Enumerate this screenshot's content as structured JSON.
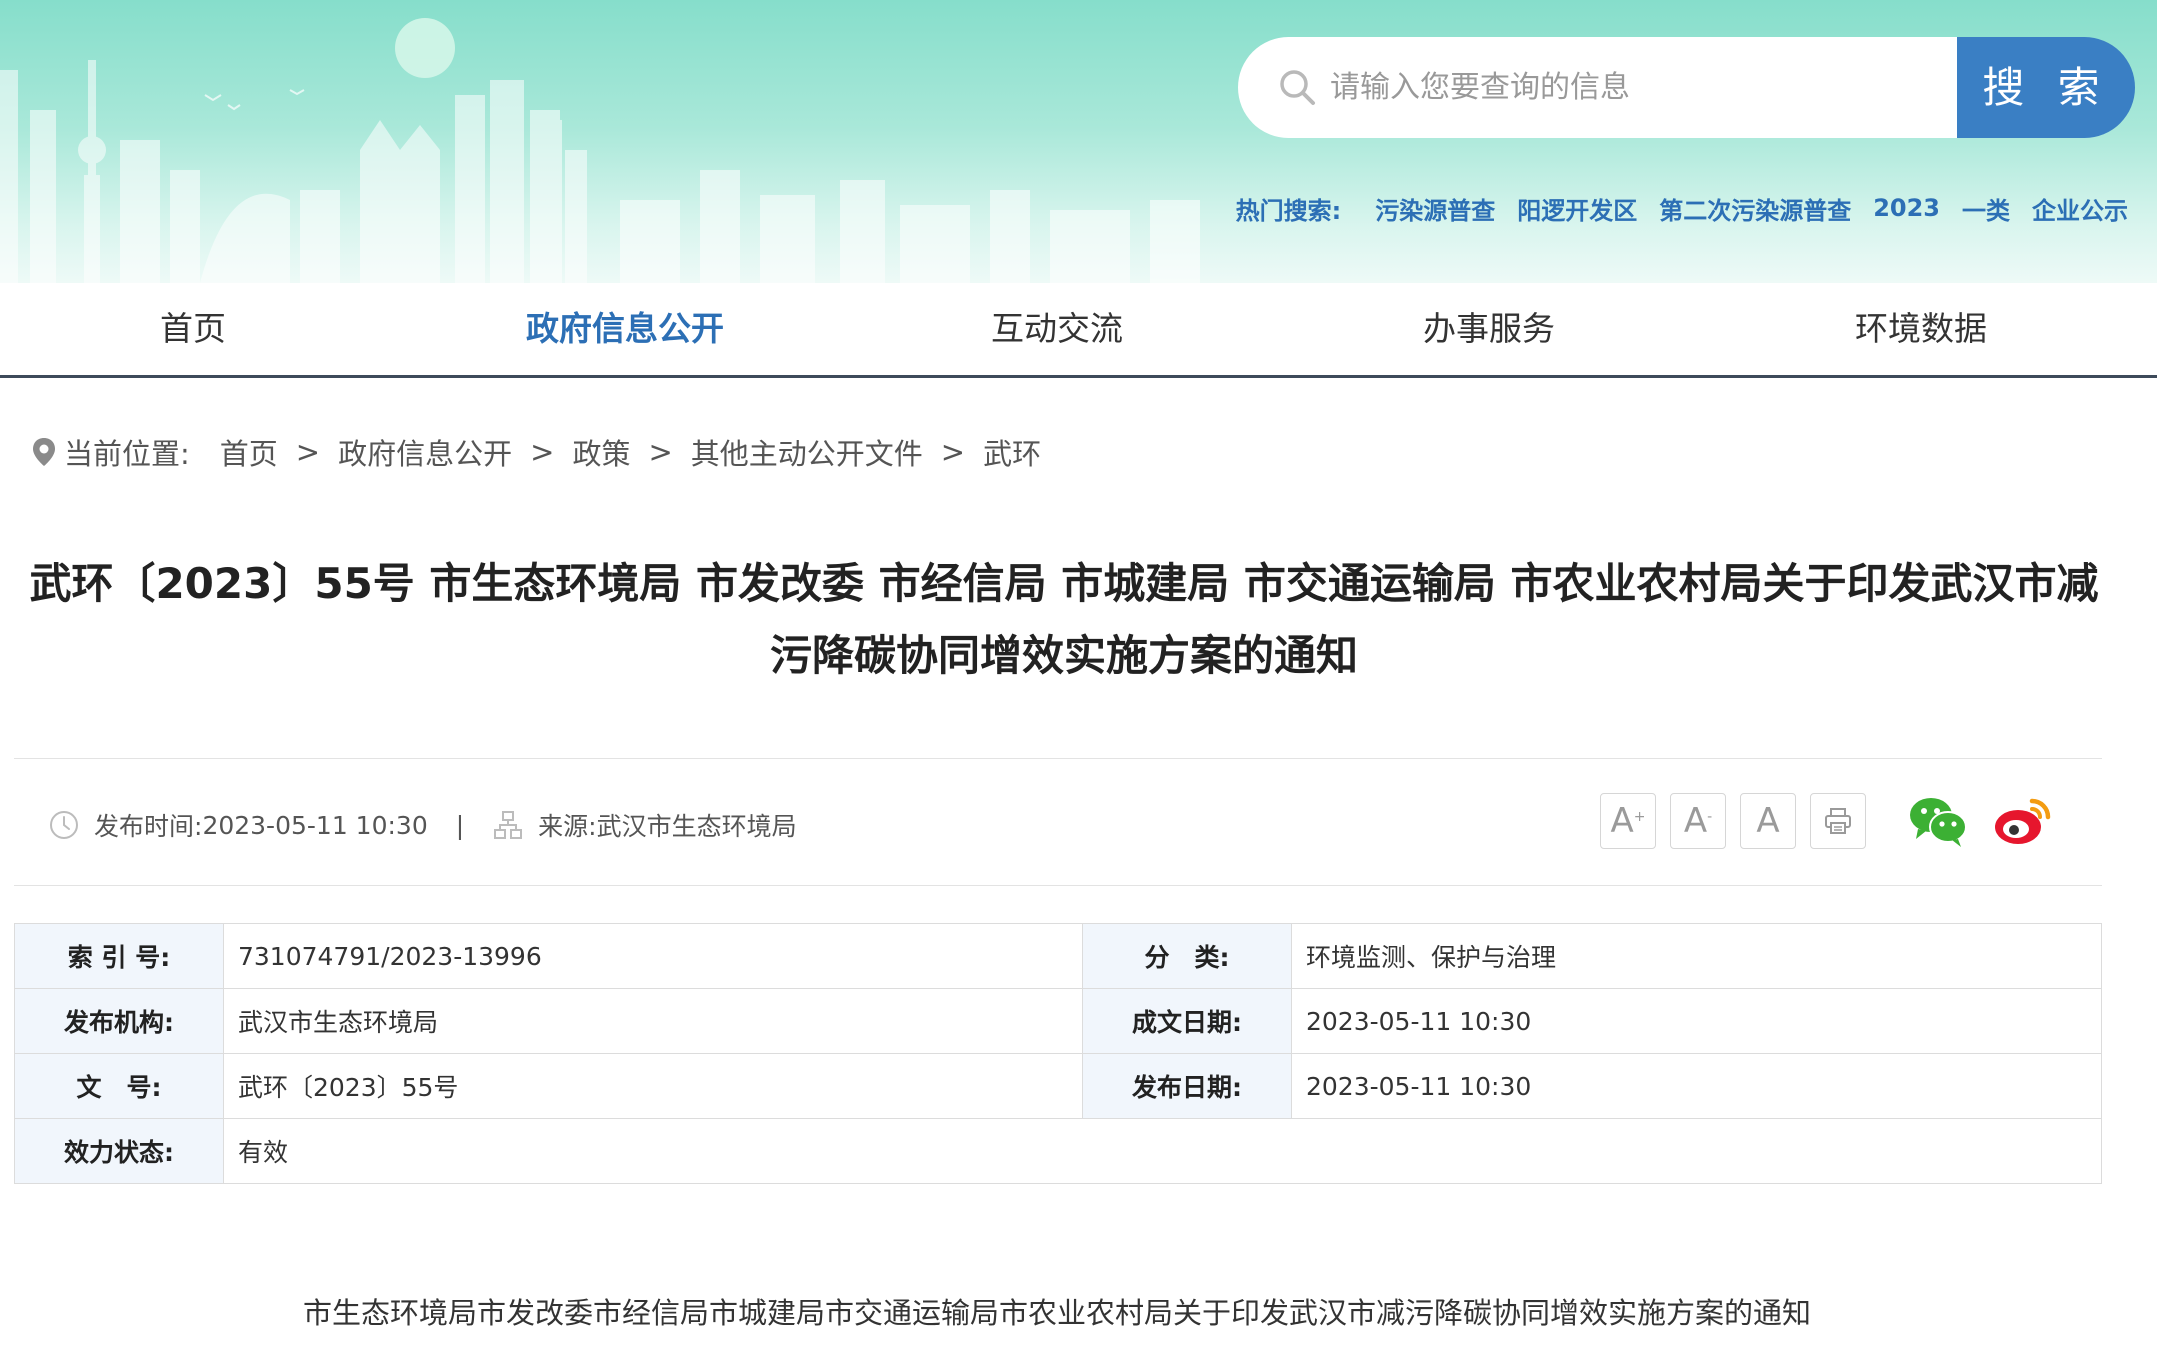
{
  "header": {
    "search_placeholder": "请输入您要查询的信息",
    "search_button": "搜 索",
    "hot_search_label": "热门搜索:",
    "hot_search_links": [
      "污染源普查",
      "阳逻开发区",
      "第二次污染源普查",
      "2023",
      "一类",
      "企业公示"
    ]
  },
  "nav": {
    "items": [
      "首页",
      "政府信息公开",
      "互动交流",
      "办事服务",
      "环境数据"
    ],
    "active": "政府信息公开"
  },
  "breadcrumb": {
    "label": "当前位置:",
    "items": [
      "首页",
      "政府信息公开",
      "政策",
      "其他主动公开文件",
      "武环"
    ],
    "separator": ">"
  },
  "article": {
    "title_line1": "武环〔2023〕55号 市生态环境局 市发改委 市经信局 市城建局 市交通运输局 市农业农村局关于印发武汉市减",
    "title_line2": "污降碳协同增效实施方案的通知",
    "publish_time_label": "发布时间:",
    "publish_time": "2023-05-11 10:30",
    "meta_divider": "|",
    "source_label": "来源:",
    "source": "武汉市生态环境局",
    "body_title": "市生态环境局市发改委市经信局市城建局市交通运输局市农业农村局关于印发武汉市减污降碳协同增效实施方案的通知"
  },
  "tools": {
    "font_increase": "A",
    "font_increase_mark": "+",
    "font_decrease": "A",
    "font_decrease_mark": "-",
    "font_reset": "A"
  },
  "info": {
    "index_label": "索 引 号:",
    "index_value": "731074791/2023-13996",
    "category_label": "分　类:",
    "category_value": "环境监测、保护与治理",
    "org_label": "发布机构:",
    "org_value": "武汉市生态环境局",
    "written_date_label": "成文日期:",
    "written_date_value": "2023-05-11 10:30",
    "doc_no_label": "文　号:",
    "doc_no_value": "武环〔2023〕55号",
    "publish_date_label": "发布日期:",
    "publish_date_value": "2023-05-11 10:30",
    "status_label": "效力状态:",
    "status_value": "有效"
  },
  "colors": {
    "accent": "#2c6fb5",
    "search_button": "#3a7fc4",
    "banner_top": "#86decb",
    "wechat": "#3cb034",
    "weibo": "#e6162d",
    "weibo_orange": "#f39c12"
  }
}
